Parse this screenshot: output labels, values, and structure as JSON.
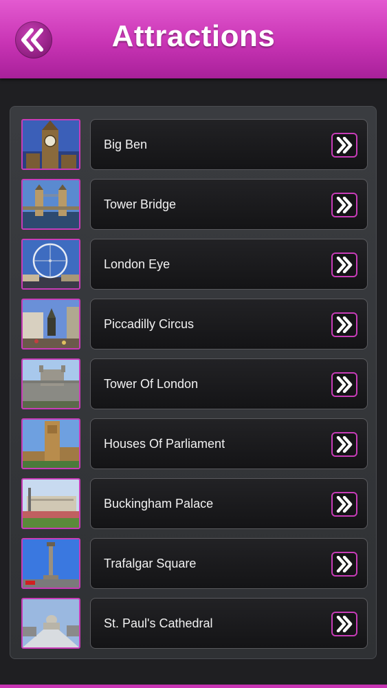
{
  "header": {
    "title": "Attractions",
    "back_icon": "double-chevron-left-icon",
    "color": "#c834b4"
  },
  "list": {
    "items": [
      {
        "label": "Big Ben"
      },
      {
        "label": "Tower Bridge"
      },
      {
        "label": "London Eye"
      },
      {
        "label": "Piccadilly Circus"
      },
      {
        "label": "Tower Of London"
      },
      {
        "label": "Houses Of Parliament"
      },
      {
        "label": "Buckingham Palace"
      },
      {
        "label": "Trafalgar Square"
      },
      {
        "label": "St. Paul's Cathedral"
      }
    ],
    "item_icon": "double-chevron-right-icon",
    "accent": "#c83cb8"
  }
}
